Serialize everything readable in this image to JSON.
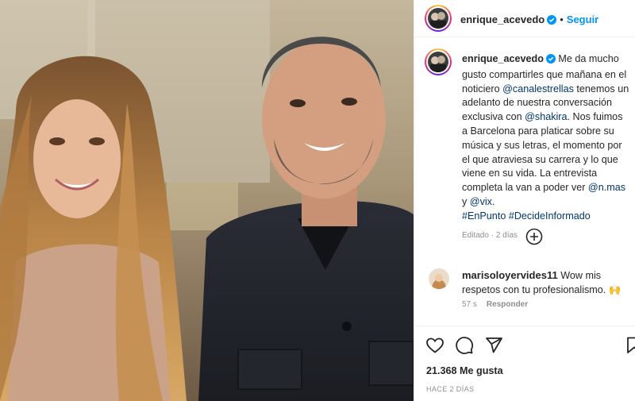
{
  "post": {
    "author": "enrique_acevedo",
    "follow_label": "Seguir",
    "separator": "•",
    "caption_text": "Me da mucho gusto compartirles que mañana en el noticiero ",
    "caption_mention_1": "@canalestrellas",
    "caption_text_2": " tenemos un adelanto de nuestra conversación exclusiva con ",
    "caption_mention_2": "@shakira",
    "caption_text_3": ". Nos fuimos a Barcelona para platicar sobre su música y sus letras, el momento por el que atraviesa su carrera y lo que viene en su vida. La entrevista completa la van a poder ver ",
    "caption_mention_3": "@n.mas",
    "caption_text_4": " y ",
    "caption_mention_4": "@vix",
    "caption_text_5": ".",
    "hashtag_1": "#EnPunto",
    "hashtag_2": "#DecideInformado",
    "edited_label": "Editado",
    "edited_dot": " · ",
    "edited_time": "2 días"
  },
  "comment": {
    "author": "marisoloyervides11",
    "text": "Wow mis respetos con tu profesionalismo.",
    "emoji": "🙌",
    "time": "57 s",
    "reply_label": "Responder"
  },
  "footer": {
    "likes": "21.368 Me gusta",
    "posted": "HACE 2 DÍAS"
  },
  "icons": {
    "header_avatar": "avatar-image",
    "verified": "verified-badge-icon",
    "add_comments": "plus-circle-icon",
    "like": "heart-icon",
    "comment": "comment-icon",
    "share": "paper-plane-icon",
    "save": "bookmark-icon"
  },
  "colors": {
    "follow": "#0095f6",
    "verified": "#0095f6",
    "link": "#00376b",
    "muted": "#8e8e8e"
  }
}
